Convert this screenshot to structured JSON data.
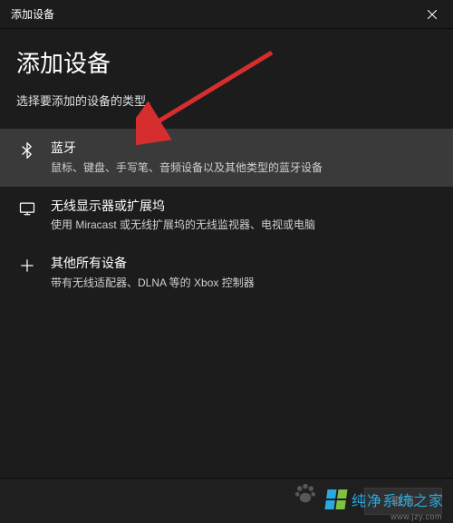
{
  "titlebar": {
    "title": "添加设备"
  },
  "heading": "添加设备",
  "subheading": "选择要添加的设备的类型。",
  "options": {
    "bluetooth": {
      "title": "蓝牙",
      "desc": "鼠标、键盘、手写笔、音频设备以及其他类型的蓝牙设备"
    },
    "wireless": {
      "title": "无线显示器或扩展坞",
      "desc": "使用 Miracast 或无线扩展坞的无线监视器、电视或电脑"
    },
    "other": {
      "title": "其他所有设备",
      "desc": "带有无线适配器、DLNA 等的 Xbox 控制器"
    }
  },
  "buttons": {
    "cancel": "取消"
  },
  "watermark": {
    "text": "纯净系统之家",
    "url": "www.jzy.com"
  },
  "colors": {
    "bg": "#1c1c1c",
    "highlight": "#3a3a3a",
    "arrow": "#d62e2e"
  }
}
